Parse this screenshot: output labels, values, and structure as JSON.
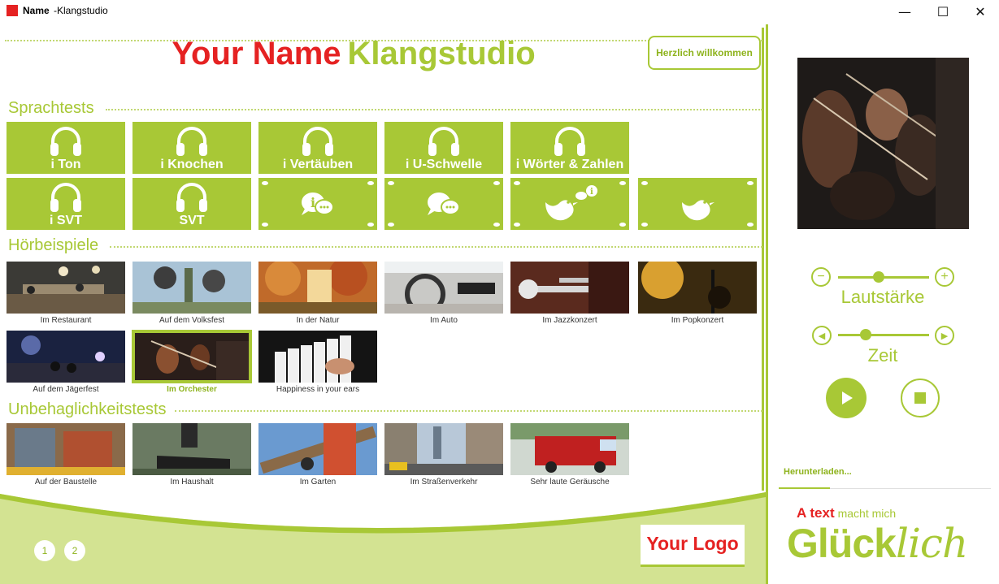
{
  "window": {
    "title_name": "Name",
    "title_sub": "-Klangstudio",
    "minimize": "—",
    "maximize": "☐",
    "close": "✕"
  },
  "header": {
    "title_red": "Your Name",
    "title_green": "Klangstudio",
    "welcome_button": "Herzlich willkommen"
  },
  "sections": {
    "sprachtests": "Sprachtests",
    "hoerbeispiele": "Hörbeispiele",
    "unbehaglichkeit": "Unbehaglichkeitstests"
  },
  "sprachtests": {
    "row1": [
      "i Ton",
      "i Knochen",
      "i Vertäuben",
      "i U-Schwelle",
      "i Wörter & Zahlen"
    ],
    "row2": [
      "i SVT",
      "SVT"
    ],
    "row2_icons": [
      "chat-info-icon",
      "chat-icon",
      "bird-info-icon",
      "bird-icon"
    ]
  },
  "hoerbeispiele": [
    "Im Restaurant",
    "Auf dem Volksfest",
    "In der Natur",
    "Im Auto",
    "Im Jazzkonzert",
    "Im Popkonzert",
    "Auf dem Jägerfest",
    "Im Orchester",
    "Happiness in your ears"
  ],
  "hoerbeispiele_selected": "Im Orchester",
  "unbehaglichkeit": [
    "Auf der Baustelle",
    "Im Haushalt",
    "Im Garten",
    "Im Straßenverkehr",
    "Sehr laute Geräusche"
  ],
  "footer": {
    "pages": [
      "1",
      "2"
    ],
    "logo": "Your Logo"
  },
  "player": {
    "volume_label": "Lautstärke",
    "volume_level": 0.45,
    "time_label": "Zeit",
    "time_level": 0.3,
    "download": "Herunterladen...",
    "download_progress": 0.24
  },
  "promo": {
    "line1_red": "A text",
    "line1_green": "macht mich",
    "line2_main": "Glück",
    "line2_italic": "lich"
  },
  "colors": {
    "accent_green": "#a8c836",
    "brand_red": "#e52222"
  }
}
